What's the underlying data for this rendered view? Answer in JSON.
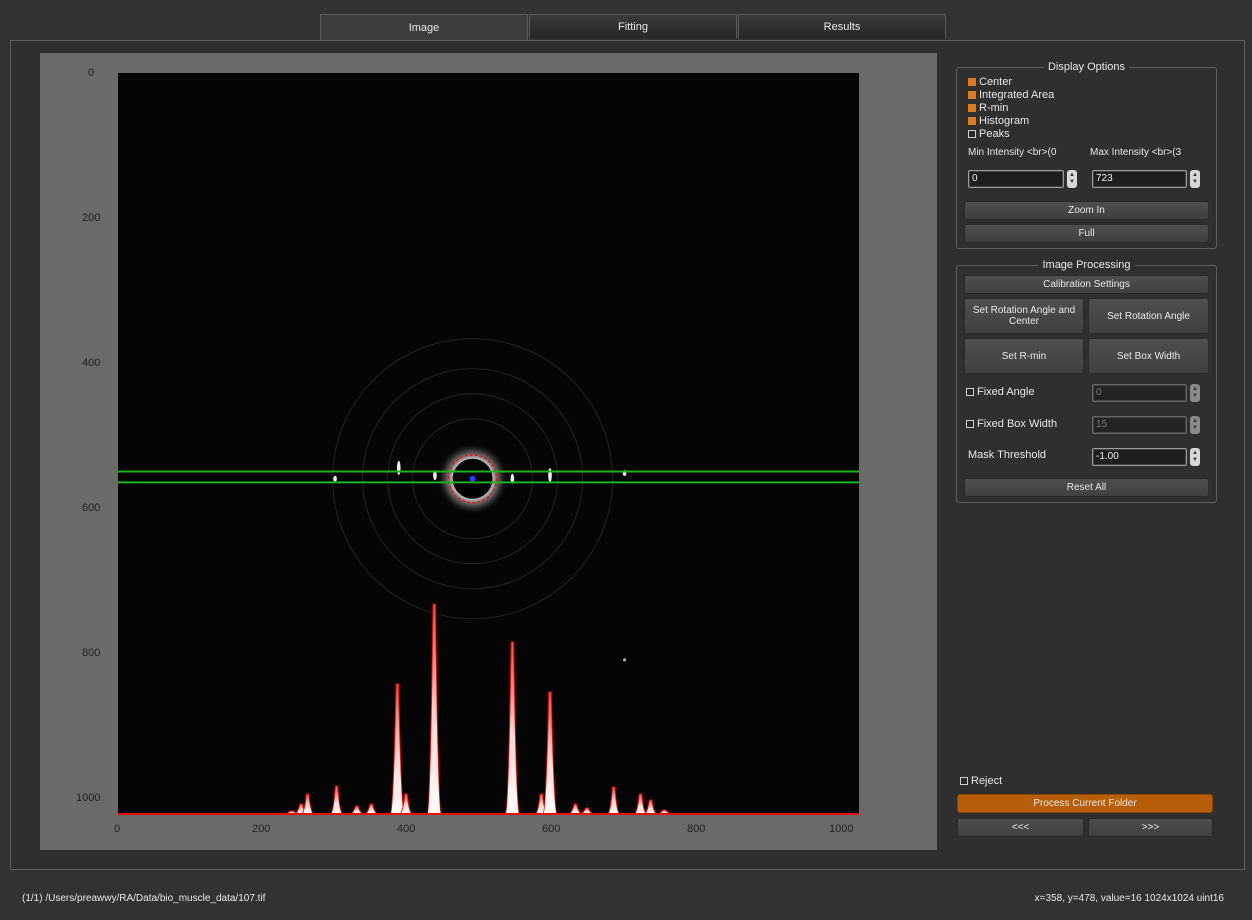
{
  "tabs": [
    {
      "label": "Image",
      "active": true
    },
    {
      "label": "Fitting",
      "active": false
    },
    {
      "label": "Results",
      "active": false
    }
  ],
  "plot": {
    "y_ticks": [
      "0",
      "200",
      "400",
      "600",
      "800",
      "1000"
    ],
    "x_ticks": [
      "0",
      "200",
      "400",
      "600",
      "800",
      "1000"
    ],
    "image_size": "1024x1024",
    "center": [
      490,
      560
    ],
    "box_band": [
      550,
      565
    ],
    "histogram_peaks": [
      {
        "x": 240,
        "h": 3
      },
      {
        "x": 253,
        "h": 10
      },
      {
        "x": 262,
        "h": 20
      },
      {
        "x": 302,
        "h": 28
      },
      {
        "x": 330,
        "h": 8
      },
      {
        "x": 350,
        "h": 10
      },
      {
        "x": 386,
        "h": 130
      },
      {
        "x": 398,
        "h": 20
      },
      {
        "x": 437,
        "h": 210
      },
      {
        "x": 545,
        "h": 172
      },
      {
        "x": 585,
        "h": 20
      },
      {
        "x": 597,
        "h": 122
      },
      {
        "x": 632,
        "h": 10
      },
      {
        "x": 648,
        "h": 6
      },
      {
        "x": 685,
        "h": 27
      },
      {
        "x": 722,
        "h": 20
      },
      {
        "x": 736,
        "h": 14
      },
      {
        "x": 755,
        "h": 4
      }
    ],
    "colors": {
      "histogram": "#e3120b",
      "box_lines": "#1db31d",
      "center": "#2a3cff",
      "rmin_circle": "#e3120b"
    }
  },
  "display_options": {
    "title": "Display Options",
    "checkboxes": [
      {
        "label": "Center",
        "checked": true
      },
      {
        "label": "Integrated Area",
        "checked": true
      },
      {
        "label": "R-min",
        "checked": true
      },
      {
        "label": "Histogram",
        "checked": true
      },
      {
        "label": "Peaks",
        "checked": false
      }
    ],
    "min_intensity_label": "Min Intensity <br>(0",
    "max_intensity_label": "Max Intensity <br>(3",
    "min_intensity_value": "0",
    "max_intensity_value": "723",
    "zoom_in_label": "Zoom In",
    "full_label": "Full"
  },
  "image_processing": {
    "title": "Image Processing",
    "calibration_label": "Calibration Settings",
    "set_rot_center_label": "Set Rotation Angle and Center",
    "set_rot_label": "Set Rotation Angle",
    "set_rmin_label": "Set R-min",
    "set_box_width_label": "Set Box Width",
    "fixed_angle_label": "Fixed Angle",
    "fixed_angle_value": "0",
    "fixed_box_width_label": "Fixed Box Width",
    "fixed_box_width_value": "15",
    "mask_threshold_label": "Mask Threshold",
    "mask_threshold_value": "-1.00",
    "reset_all_label": "Reset All"
  },
  "bottom_controls": {
    "reject_label": "Reject",
    "process_folder_label": "Process Current Folder",
    "prev_label": "<<<",
    "next_label": ">>>"
  },
  "status": {
    "file_path": "(1/1) /Users/preawwy/RA/Data/bio_muscle_data/107.tif",
    "cursor_info": "x=358, y=478, value=16  1024x1024 uint16"
  }
}
